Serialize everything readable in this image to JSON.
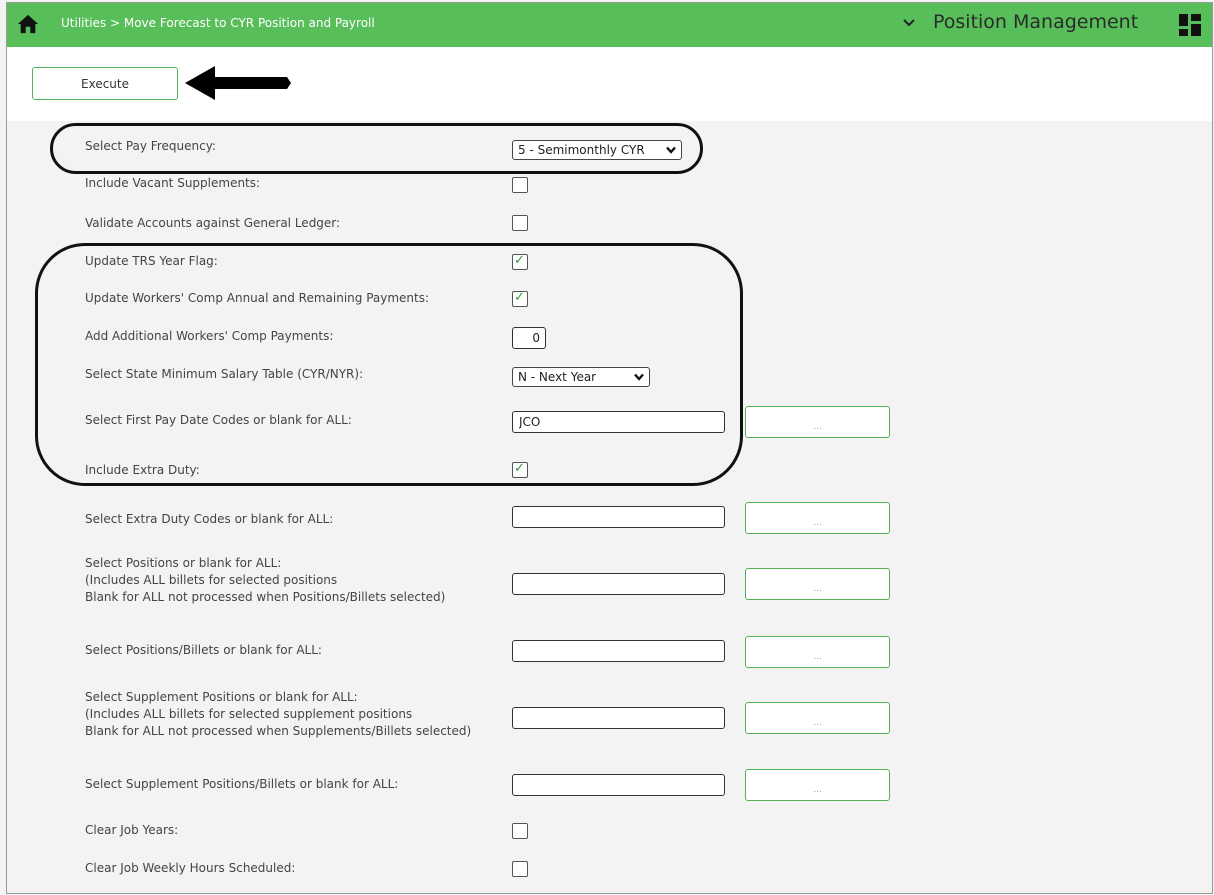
{
  "header": {
    "breadcrumb": "Utilities > Move Forecast to CYR Position and Payroll",
    "app_title": "Position Management",
    "home_icon": "home-icon",
    "menu_icon": "chevron-down-icon",
    "grid_icon": "dashboard-grid-icon"
  },
  "toolbar": {
    "execute_label": "Execute"
  },
  "form": {
    "pay_frequency": {
      "label": "Select Pay Frequency:",
      "value": "5 - Semimonthly CYR"
    },
    "vacant_supplements": {
      "label": "Include Vacant Supplements:",
      "checked": false
    },
    "validate_accounts": {
      "label": "Validate Accounts against General Ledger:",
      "checked": false
    },
    "trs_year_flag": {
      "label": "Update TRS Year Flag:",
      "checked": true
    },
    "workers_comp_annual": {
      "label": "Update Workers' Comp Annual and Remaining Payments:",
      "checked": true
    },
    "add_workers_comp": {
      "label": "Add Additional Workers' Comp Payments:",
      "value": "0"
    },
    "state_min_salary": {
      "label": "Select State Minimum Salary Table (CYR/NYR):",
      "value": "N - Next Year"
    },
    "first_pay_date": {
      "label": "Select First Pay Date Codes or blank for ALL:",
      "value": "JCO"
    },
    "include_extra_duty": {
      "label": "Include Extra Duty:",
      "checked": true
    },
    "extra_duty_codes": {
      "label": "Select Extra Duty Codes or blank for ALL:",
      "value": ""
    },
    "positions": {
      "label1": "Select Positions or blank for ALL:",
      "label2": "(Includes ALL billets for selected positions",
      "label3": "Blank for ALL not processed when Positions/Billets selected)",
      "value": ""
    },
    "positions_billets": {
      "label": "Select Positions/Billets or blank for ALL:",
      "value": ""
    },
    "supplement_positions": {
      "label1": "Select Supplement Positions or blank for ALL:",
      "label2": "(Includes ALL billets for selected supplement positions",
      "label3": "Blank for ALL not processed when Supplements/Billets selected)",
      "value": ""
    },
    "supplement_billets": {
      "label": "Select Supplement Positions/Billets or blank for ALL:",
      "value": ""
    },
    "clear_job_years": {
      "label": "Clear Job Years:",
      "checked": false
    },
    "clear_weekly_hours": {
      "label": "Clear Job Weekly Hours Scheduled:",
      "checked": false
    },
    "lookup_label": "..."
  },
  "colors": {
    "header_green": "#58be5a",
    "border_green": "#55b257",
    "check_green": "#2e9a33"
  }
}
